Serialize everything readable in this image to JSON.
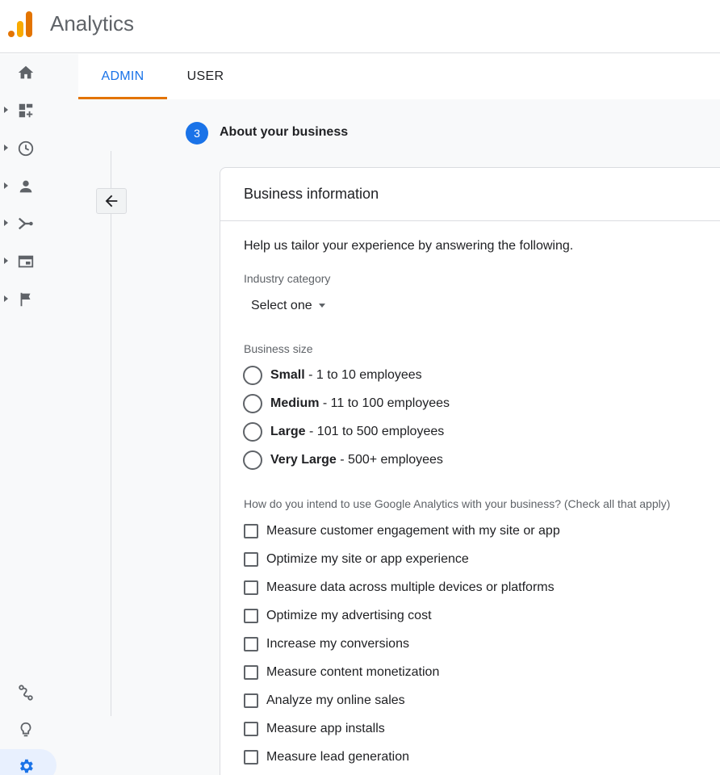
{
  "app": {
    "title": "Analytics"
  },
  "tabs": {
    "admin": "ADMIN",
    "user": "USER"
  },
  "step": {
    "number": "3",
    "title": "About your business"
  },
  "card": {
    "title": "Business information",
    "intro": "Help us tailor your experience by answering the following.",
    "industry": {
      "label": "Industry category",
      "selected": "Select one"
    },
    "size": {
      "label": "Business size",
      "options": [
        {
          "name": "Small",
          "detail": " - 1 to 10 employees"
        },
        {
          "name": "Medium",
          "detail": " - 11 to 100 employees"
        },
        {
          "name": "Large",
          "detail": " - 101 to 500 employees"
        },
        {
          "name": "Very Large",
          "detail": " - 500+ employees"
        }
      ]
    },
    "intent": {
      "label": "How do you intend to use Google Analytics with your business? (Check all that apply)",
      "options": [
        "Measure customer engagement with my site or app",
        "Optimize my site or app experience",
        "Measure data across multiple devices or platforms",
        "Optimize my advertising cost",
        "Increase my conversions",
        "Measure content monetization",
        "Analyze my online sales",
        "Measure app installs",
        "Measure lead generation"
      ]
    }
  },
  "colors": {
    "accent": "#1a73e8",
    "tab_indicator": "#e37400",
    "logo_dark": "#e37400",
    "logo_light": "#f9ab00"
  },
  "icons": [
    "home-icon",
    "dashboard-icon",
    "clock-icon",
    "person-icon",
    "flow-icon",
    "page-icon",
    "flag-icon",
    "route-icon",
    "lightbulb-icon",
    "gear-icon",
    "arrow-back-icon"
  ]
}
